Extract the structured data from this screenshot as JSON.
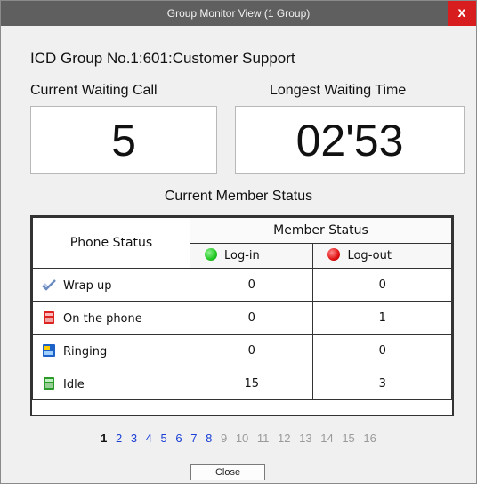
{
  "window": {
    "title": "Group Monitor View (1 Group)",
    "close_glyph": "x",
    "colors": {
      "titlebar": "#5f5f5f",
      "close": "#d71d1d"
    }
  },
  "group_name": "ICD Group No.1:601:Customer Support",
  "current_waiting_call": {
    "label": "Current Waiting Call",
    "value": "5"
  },
  "longest_waiting_time": {
    "label": "Longest Waiting Time",
    "value": "02'53"
  },
  "member_status_section": {
    "label": "Current Member Status",
    "table": {
      "phone_status_header": "Phone Status",
      "member_status_header": "Member Status",
      "login_header": "Log-in",
      "logout_header": "Log-out",
      "login_color": "#22c722",
      "logout_color": "#e01010",
      "rows": [
        {
          "icon": "wrap-up-icon",
          "status": "Wrap up",
          "login": "0",
          "logout": "0"
        },
        {
          "icon": "on-phone-icon",
          "status": "On the phone",
          "login": "0",
          "logout": "1"
        },
        {
          "icon": "ringing-icon",
          "status": "Ringing",
          "login": "0",
          "logout": "0"
        },
        {
          "icon": "idle-icon",
          "status": "Idle",
          "login": "15",
          "logout": "3"
        }
      ]
    }
  },
  "pagination": {
    "current": "1",
    "active_pages": [
      "2",
      "3",
      "4",
      "5",
      "6",
      "7",
      "8"
    ],
    "inactive_pages": [
      "9",
      "10",
      "11",
      "12",
      "13",
      "14",
      "15",
      "16"
    ]
  },
  "close_button": {
    "label": "Close"
  }
}
